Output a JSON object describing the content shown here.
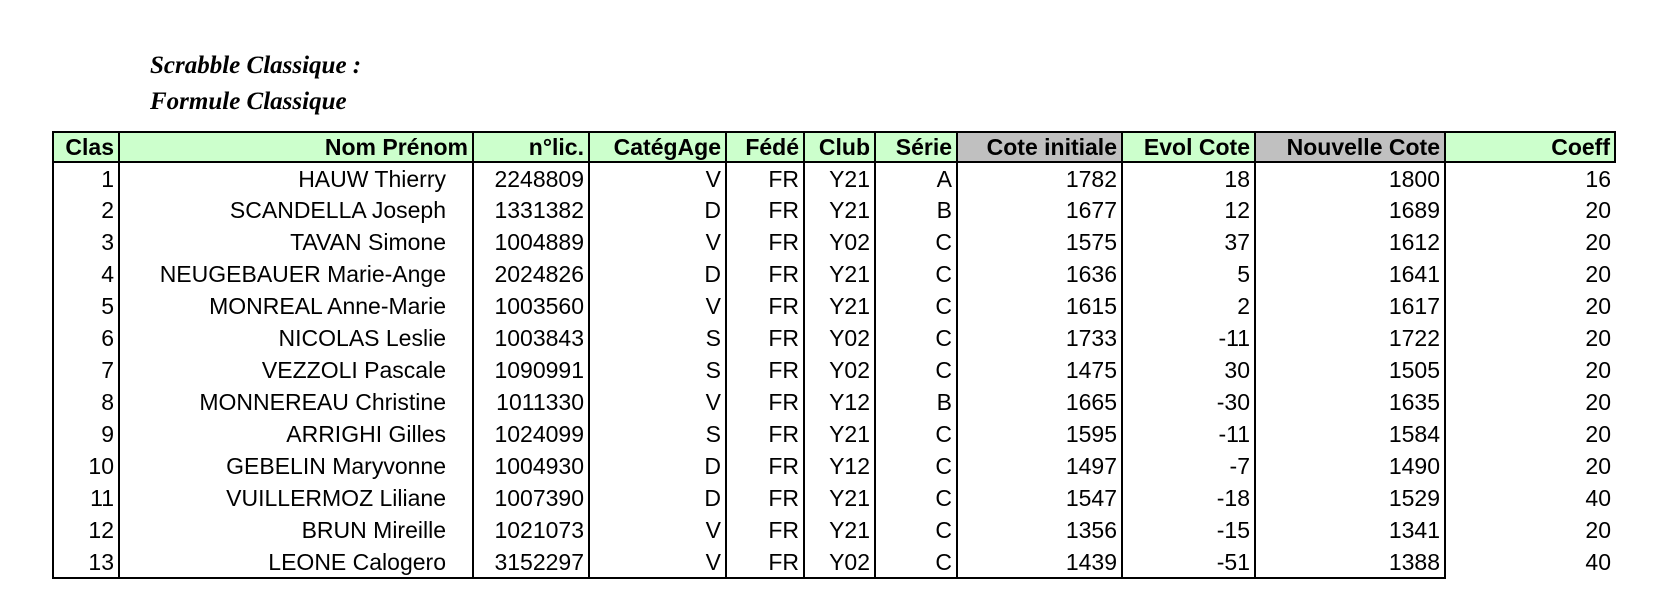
{
  "title": {
    "line1": "Scrabble Classique :",
    "line2": "Formule Classique"
  },
  "table": {
    "headers": [
      "Clas",
      "Nom Prénom",
      "n°lic.",
      "CatégAge",
      "Fédé",
      "Club",
      "Série",
      "Cote initiale",
      "Evol Cote",
      "Nouvelle Cote",
      "Coeff"
    ],
    "header_colors": {
      "default": "#ccffcc",
      "grey": "#c0c0c0"
    },
    "rows": [
      [
        "1",
        "HAUW Thierry",
        "2248809",
        "V",
        "FR",
        "Y21",
        "A",
        "1782",
        "18",
        "1800",
        "16"
      ],
      [
        "2",
        "SCANDELLA Joseph",
        "1331382",
        "D",
        "FR",
        "Y21",
        "B",
        "1677",
        "12",
        "1689",
        "20"
      ],
      [
        "3",
        "TAVAN Simone",
        "1004889",
        "V",
        "FR",
        "Y02",
        "C",
        "1575",
        "37",
        "1612",
        "20"
      ],
      [
        "4",
        "NEUGEBAUER Marie-Ange",
        "2024826",
        "D",
        "FR",
        "Y21",
        "C",
        "1636",
        "5",
        "1641",
        "20"
      ],
      [
        "5",
        "MONREAL Anne-Marie",
        "1003560",
        "V",
        "FR",
        "Y21",
        "C",
        "1615",
        "2",
        "1617",
        "20"
      ],
      [
        "6",
        "NICOLAS Leslie",
        "1003843",
        "S",
        "FR",
        "Y02",
        "C",
        "1733",
        "-11",
        "1722",
        "20"
      ],
      [
        "7",
        "VEZZOLI Pascale",
        "1090991",
        "S",
        "FR",
        "Y02",
        "C",
        "1475",
        "30",
        "1505",
        "20"
      ],
      [
        "8",
        "MONNEREAU Christine",
        "1011330",
        "V",
        "FR",
        "Y12",
        "B",
        "1665",
        "-30",
        "1635",
        "20"
      ],
      [
        "9",
        "ARRIGHI Gilles",
        "1024099",
        "S",
        "FR",
        "Y21",
        "C",
        "1595",
        "-11",
        "1584",
        "20"
      ],
      [
        "10",
        "GEBELIN Maryvonne",
        "1004930",
        "D",
        "FR",
        "Y12",
        "C",
        "1497",
        "-7",
        "1490",
        "20"
      ],
      [
        "11",
        "VUILLERMOZ Liliane",
        "1007390",
        "D",
        "FR",
        "Y21",
        "C",
        "1547",
        "-18",
        "1529",
        "40"
      ],
      [
        "12",
        "BRUN Mireille",
        "1021073",
        "V",
        "FR",
        "Y21",
        "C",
        "1356",
        "-15",
        "1341",
        "20"
      ],
      [
        "13",
        "LEONE Calogero",
        "3152297",
        "V",
        "FR",
        "Y02",
        "C",
        "1439",
        "-51",
        "1388",
        "40"
      ]
    ]
  }
}
